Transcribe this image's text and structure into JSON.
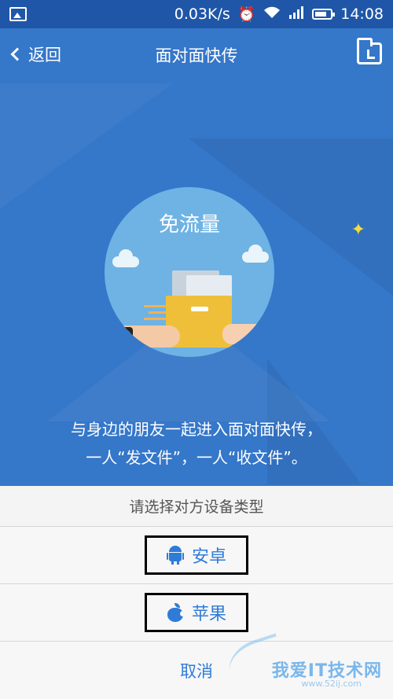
{
  "status_bar": {
    "speed": "0.03K/s",
    "time": "14:08",
    "icons": [
      "gallery-icon",
      "alarm-icon",
      "wifi-icon",
      "signal-icon",
      "battery-icon"
    ]
  },
  "nav": {
    "back_label": "返回",
    "title": "面对面快传"
  },
  "hero": {
    "badge_text": "免流量",
    "description_line1": "与身边的朋友一起进入面对面快传，",
    "description_line2": "一人“发文件”，一人“收文件”。"
  },
  "sheet": {
    "header": "请选择对方设备类型",
    "options": [
      {
        "label": "安卓",
        "icon": "android-icon"
      },
      {
        "label": "苹果",
        "icon": "apple-icon"
      }
    ],
    "cancel_label": "取消"
  },
  "watermark": {
    "text": "我爱IT技术网",
    "url": "www.52ij.com"
  },
  "colors": {
    "primary_blue": "#3577c9",
    "status_blue": "#1f56a8",
    "link_blue": "#2f7bd8",
    "circle_blue": "#6eb3e4"
  }
}
